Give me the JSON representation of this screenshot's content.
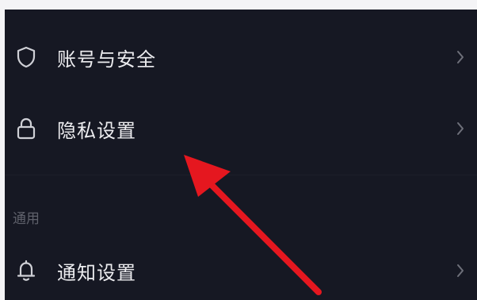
{
  "settings": {
    "items": [
      {
        "label": "账号与安全",
        "icon": "shield-icon"
      },
      {
        "label": "隐私设置",
        "icon": "lock-icon"
      }
    ],
    "section_general": {
      "title": "通用",
      "items": [
        {
          "label": "通知设置",
          "icon": "bell-icon"
        }
      ]
    }
  },
  "colors": {
    "background": "#161823",
    "text": "#ececef",
    "section_title": "#5f616b",
    "icon": "#cfd0d6",
    "chevron": "#6e707a",
    "annotation_arrow": "#e5171f"
  }
}
